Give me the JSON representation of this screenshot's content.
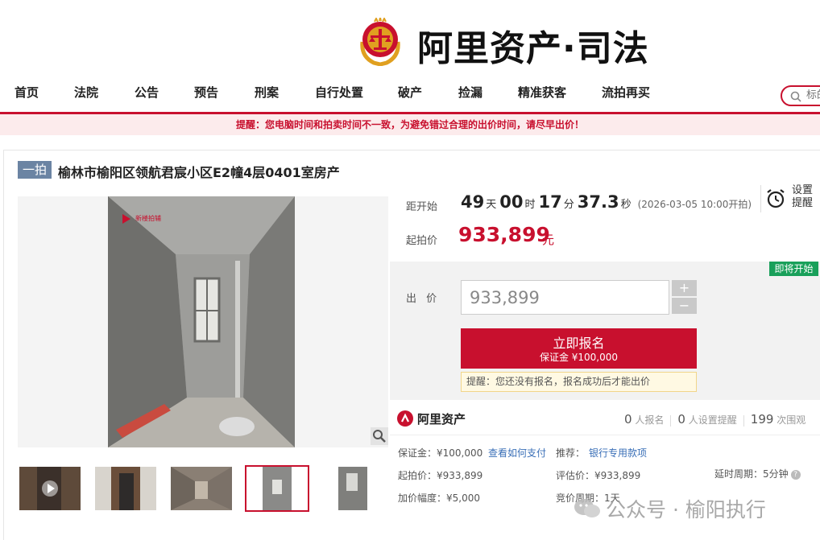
{
  "header": {
    "brand": "阿里资产·司法",
    "emblem_icon": "court-emblem-icon"
  },
  "nav": {
    "items": [
      "首页",
      "法院",
      "公告",
      "预告",
      "刑案",
      "自行处置",
      "破产",
      "捡漏",
      "精准获客",
      "流拍再买"
    ],
    "search_placeholder": "标的"
  },
  "alert": "提醒：您电脑时间和拍卖时间不一致，为避免错过合理的出价时间，请尽早出价！",
  "item": {
    "round_badge": "一拍",
    "title": "榆林市榆阳区领航君宸小区E2幢4层0401室房产"
  },
  "gallery": {
    "photo_watermark": "新楼拍辅",
    "thumbnails": [
      {
        "name": "thumb-door-video",
        "selected": false
      },
      {
        "name": "thumb-doorway",
        "selected": false
      },
      {
        "name": "thumb-corridor",
        "selected": false
      },
      {
        "name": "thumb-room",
        "selected": true
      },
      {
        "name": "thumb-wall",
        "selected": false
      }
    ]
  },
  "auction": {
    "countdown_label": "距开始",
    "days": "49",
    "days_unit": "天",
    "hours": "00",
    "hours_unit": "时",
    "minutes": "17",
    "minutes_unit": "分",
    "seconds": "37.3",
    "seconds_unit": "秒",
    "start_time_note": "(2026-03-05 10:00开拍)",
    "remind_label": "设置提醒",
    "start_price_label": "起拍价",
    "start_price": "933,899",
    "start_price_unit": "元",
    "status_badge": "即将开始",
    "bid_label": "出 价",
    "bid_value": "933,899",
    "plus": "+",
    "minus": "−",
    "register_label": "立即报名",
    "deposit_label": "保证金 ¥100,000",
    "register_tip": "提醒：您还没有报名，报名成功后才能出价"
  },
  "info": {
    "logo_text": "阿里资产",
    "registrants": "0",
    "registrants_label": "人报名",
    "reminders": "0",
    "reminders_label": "人设置提醒",
    "views": "199",
    "views_label": "次围观",
    "deposit": "保证金：¥100,000",
    "how_to_pay": "查看如何支付",
    "recommend_label": "推荐：",
    "recommend_link": "银行专用款项",
    "start_price": "起拍价：¥933,899",
    "appraisal": "评估价：¥933,899",
    "delay": "延时周期：5分钟",
    "increment": "加价幅度：¥5,000",
    "bid_cycle": "竞价周期：1天"
  },
  "watermark": "公众号 · 榆阳执行",
  "colors": {
    "accent": "#c8102e",
    "badge_blue": "#6b84a3",
    "badge_green": "#19a05a",
    "link": "#3a6fb7"
  }
}
